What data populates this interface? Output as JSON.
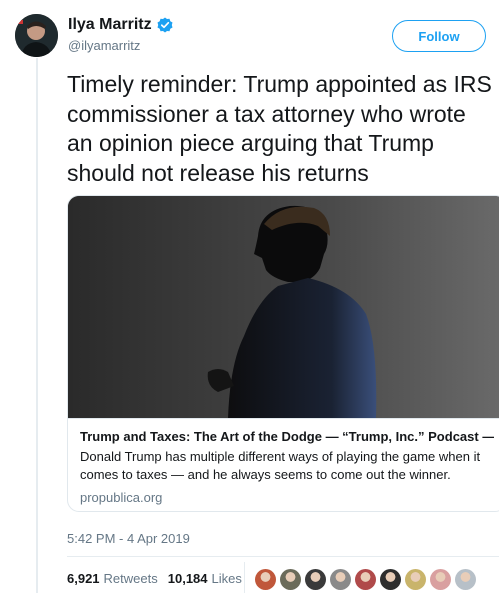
{
  "user": {
    "display_name": "Ilya Marritz",
    "handle": "@ilyamarritz",
    "verified": true
  },
  "follow_label": "Follow",
  "tweet": {
    "text": "Timely reminder: Trump appointed as IRS commissioner a tax attorney who wrote an opinion piece arguing that Trump should not release his returns"
  },
  "card": {
    "title": "Trump and Taxes: The Art of the Dodge — “Trump, Inc.” Podcast — ...",
    "description": "Donald Trump has multiple different ways of playing the game when it comes to taxes — and he always seems to come out the winner.",
    "domain": "propublica.org"
  },
  "timestamp": "5:42 PM - 4 Apr 2019",
  "stats": {
    "retweets_count": "6,921",
    "retweets_label": "Retweets",
    "likes_count": "10,184",
    "likes_label": "Likes"
  },
  "likers": [
    {
      "icon": "liker-avatar",
      "color": "#c0573a"
    },
    {
      "icon": "liker-avatar",
      "color": "#6b6b5a"
    },
    {
      "icon": "liker-avatar",
      "color": "#3a3a3a"
    },
    {
      "icon": "liker-avatar",
      "color": "#8a8a8a"
    },
    {
      "icon": "liker-avatar",
      "color": "#b04a4a"
    },
    {
      "icon": "liker-avatar",
      "color": "#2e2e2e"
    },
    {
      "icon": "liker-avatar",
      "color": "#c9b46b"
    },
    {
      "icon": "liker-avatar",
      "color": "#d9a0a0"
    },
    {
      "icon": "liker-avatar",
      "color": "#b7c0c8"
    }
  ],
  "colors": {
    "accent": "#1da1f2",
    "muted": "#657786",
    "border": "#e1e8ed"
  }
}
